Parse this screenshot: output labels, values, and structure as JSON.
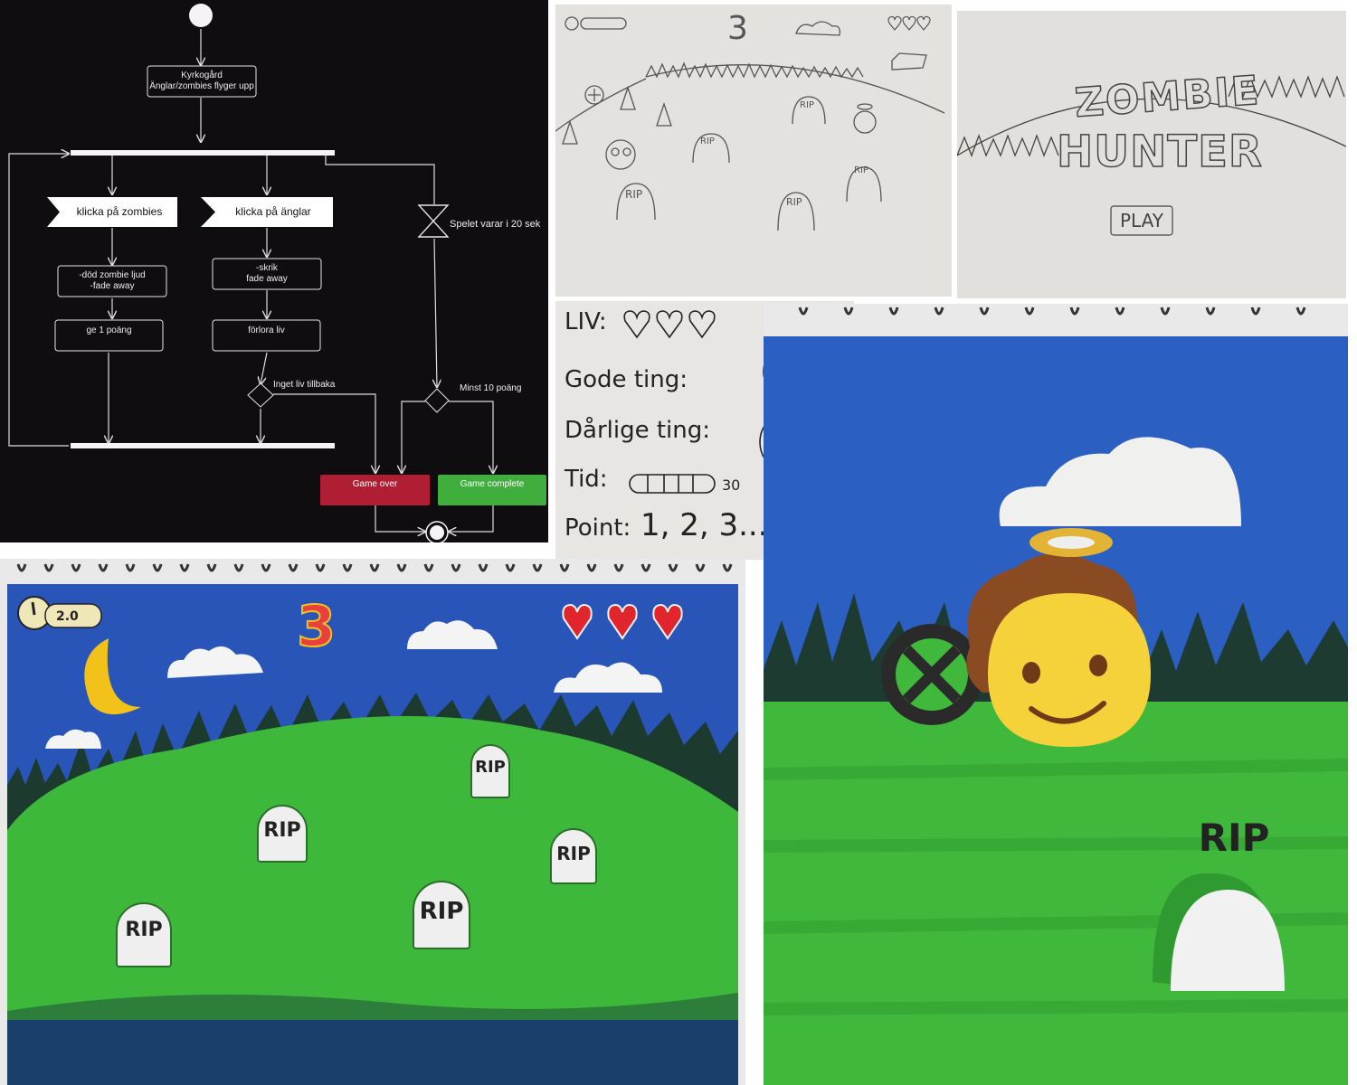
{
  "activity_diagram": {
    "start_action": "Kyrkogård\nÄnglar/zombies flyger upp",
    "signal_zombies": "klicka på zombies",
    "signal_angels": "klicka på änglar",
    "zombie_effect": "-död zombie ljud\n-fade away",
    "zombie_points": "ge 1 poäng",
    "angel_effect": "-skrik\nfade away",
    "angel_life": "förlora liv",
    "timer_label": "Spelet varar i 20 sek",
    "guard_no_life": "Inget liv tillbaka",
    "guard_min_points": "Minst 10 poäng",
    "game_over": "Game over",
    "game_complete": "Game complete",
    "colors": {
      "background": "#0f0d10",
      "game_over": "#b01e33",
      "game_complete": "#3fae3c"
    }
  },
  "sketch_gameplay": {
    "level_number": "3",
    "tombstone_label": "RIP"
  },
  "sketch_title": {
    "title_word1": "ZOMBIE",
    "title_word2": "HUNTER",
    "play_button": "PLAY"
  },
  "legend_sketch": {
    "lives": "LIV:",
    "good_things": "Gode ting:",
    "bad_things": "Dårlige ting:",
    "time": "Tid:",
    "time_value": "30",
    "points": "Point:",
    "points_value": "1, 2, 3..."
  },
  "painted_gameplay": {
    "timer_value": "2.0",
    "level_number": "3",
    "lives_count": 3,
    "tombstone_label": "RIP",
    "colors": {
      "sky": "#2a55b8",
      "grass": "#3db83a",
      "heart": "#e0262c",
      "moon": "#f2c21b"
    }
  },
  "painted_closeup": {
    "tombstone_label": "RIP",
    "colors": {
      "sky": "#2c5fc2",
      "grass": "#3fb83c",
      "face": "#f6d23a",
      "hair": "#8a4a22"
    }
  }
}
